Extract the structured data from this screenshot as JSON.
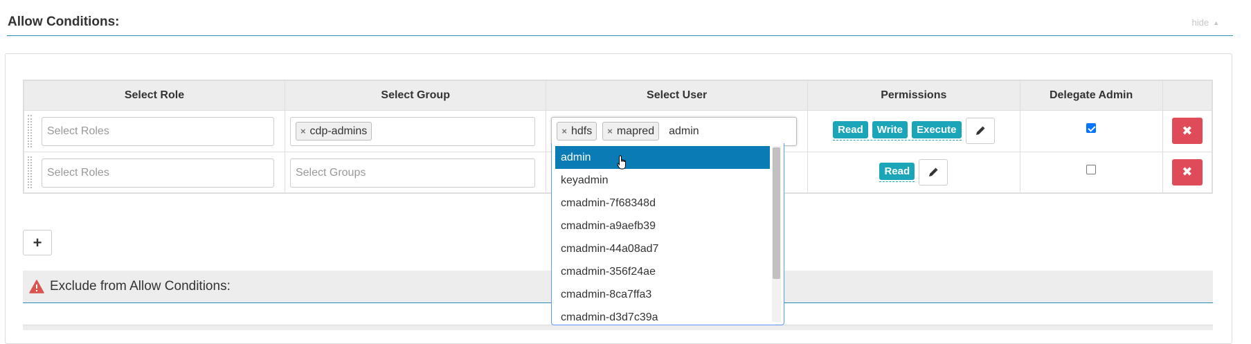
{
  "section": {
    "title": "Allow Conditions:",
    "hide_label": "hide",
    "hide_caret": "▲"
  },
  "table": {
    "headers": [
      "Select Role",
      "Select Group",
      "Select User",
      "Permissions",
      "Delegate Admin",
      ""
    ],
    "rows": [
      {
        "role_placeholder": "Select Roles",
        "groups": [
          "cdp-admins"
        ],
        "users": [
          "hdfs",
          "mapred"
        ],
        "user_typed": "admin",
        "permissions": [
          "Read",
          "Write",
          "Execute"
        ],
        "delegate_admin": true
      },
      {
        "role_placeholder": "Select Roles",
        "group_placeholder": "Select Groups",
        "permissions": [
          "Read"
        ],
        "delegate_admin": false
      }
    ]
  },
  "dropdown": {
    "options": [
      "admin",
      "keyadmin",
      "cmadmin-7f68348d",
      "cmadmin-a9aefb39",
      "cmadmin-44a08ad7",
      "cmadmin-356f24ae",
      "cmadmin-8ca7ffa3",
      "cmadmin-d3d7c39a"
    ],
    "highlighted_index": 0
  },
  "add_button_glyph": "+",
  "exclude": {
    "title": "Exclude from Allow Conditions:"
  },
  "icons": {
    "tag_remove": "×",
    "edit": "pencil-icon",
    "delete": "✖",
    "warning": "warning-icon"
  },
  "colors": {
    "accent": "#2a8bb5",
    "permission_badge": "#1aa5b8",
    "delete_button": "#e04b59",
    "highlight": "#0a7bb4",
    "warning": "#d9534f"
  }
}
